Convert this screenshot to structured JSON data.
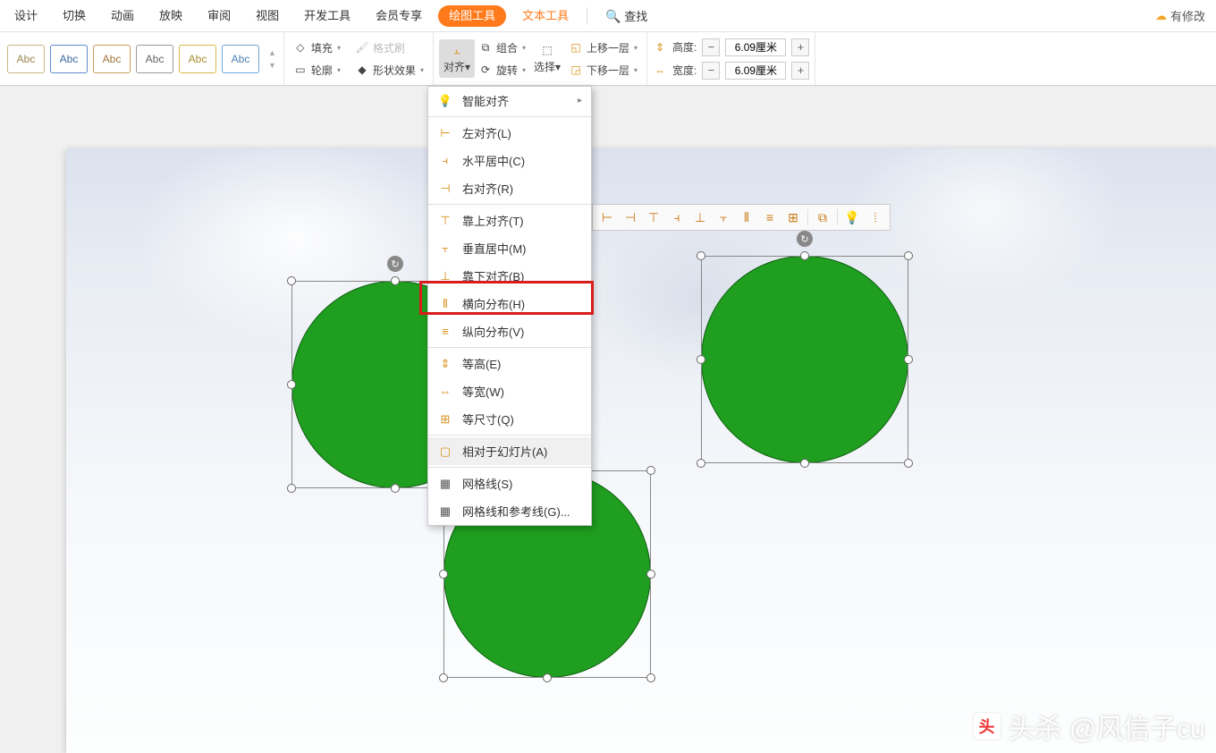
{
  "menu": {
    "tabs": [
      "设计",
      "切换",
      "动画",
      "放映",
      "审阅",
      "视图",
      "开发工具",
      "会员专享"
    ],
    "drawing_tools": "绘图工具",
    "text_tools": "文本工具",
    "find": "查找",
    "modified": "有修改"
  },
  "toolbar": {
    "abc_label": "Abc",
    "abc_colors": [
      "#c9b681",
      "#5b8bc9",
      "#c99c5b",
      "#999999",
      "#d9b84a",
      "#6aa6d9"
    ],
    "fill": "填充",
    "outline": "轮廓",
    "format_painter": "格式刷",
    "shape_effects": "形状效果",
    "align": "对齐",
    "group": "组合",
    "rotate": "旋转",
    "select": "选择",
    "bring_forward": "上移一层",
    "send_backward": "下移一层",
    "height_label": "高度:",
    "width_label": "宽度:",
    "height_value": "6.09厘米",
    "width_value": "6.09厘米"
  },
  "dropdown": {
    "smart_align": "智能对齐",
    "align_left": "左对齐(L)",
    "align_center_h": "水平居中(C)",
    "align_right": "右对齐(R)",
    "align_top": "靠上对齐(T)",
    "align_middle_v": "垂直居中(M)",
    "align_bottom": "靠下对齐(B)",
    "distribute_h": "横向分布(H)",
    "distribute_v": "纵向分布(V)",
    "equal_height": "等高(E)",
    "equal_width": "等宽(W)",
    "equal_size": "等尺寸(Q)",
    "relative_slide": "相对于幻灯片(A)",
    "gridlines": "网格线(S)",
    "grid_guides": "网格线和参考线(G)..."
  },
  "watermark": "头杀 @风信子cu"
}
